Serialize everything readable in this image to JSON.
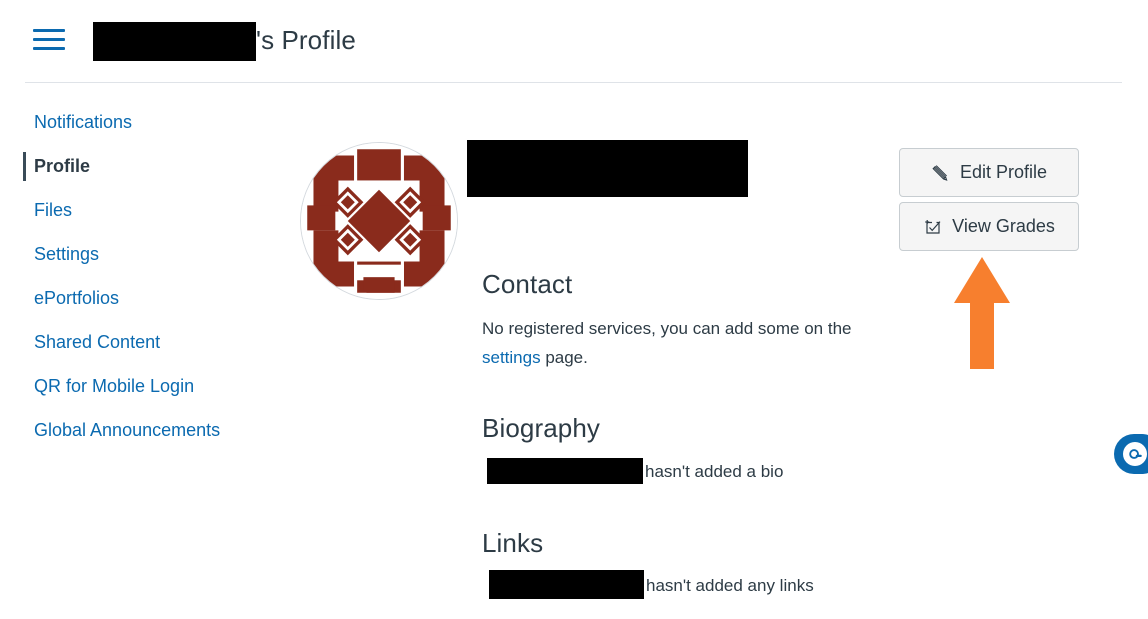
{
  "header": {
    "menu_icon": "hamburger-menu-icon",
    "redacted_name": "",
    "title_suffix": "'s Profile"
  },
  "sidebar": {
    "items": [
      {
        "label": "Notifications",
        "active": false
      },
      {
        "label": "Profile",
        "active": true
      },
      {
        "label": "Files",
        "active": false
      },
      {
        "label": "Settings",
        "active": false
      },
      {
        "label": "ePortfolios",
        "active": false
      },
      {
        "label": "Shared Content",
        "active": false
      },
      {
        "label": "QR for Mobile Login",
        "active": false
      },
      {
        "label": "Global Announcements",
        "active": false
      }
    ]
  },
  "profile": {
    "avatar_alt": "identicon-avatar",
    "avatar_color": "#8a2b1c",
    "name_redacted": "",
    "contact": {
      "heading": "Contact",
      "text_before": "No registered services, you can add some on the ",
      "link_label": "settings",
      "text_after": " page."
    },
    "biography": {
      "heading": "Biography",
      "redacted_name": "",
      "text": "hasn't added a bio"
    },
    "links": {
      "heading": "Links",
      "redacted_name": "",
      "text": "hasn't added any links"
    }
  },
  "actions": {
    "edit_profile": {
      "label": "Edit Profile",
      "icon": "pencil-icon"
    },
    "view_grades": {
      "label": "View Grades",
      "icon": "gradebook-check-icon"
    }
  },
  "annotation": {
    "arrow_color": "#F77F2E",
    "points_to": "View Grades"
  },
  "chat_widget": {
    "icon": "chat-bubble-icon",
    "color": "#0b6ab0"
  }
}
